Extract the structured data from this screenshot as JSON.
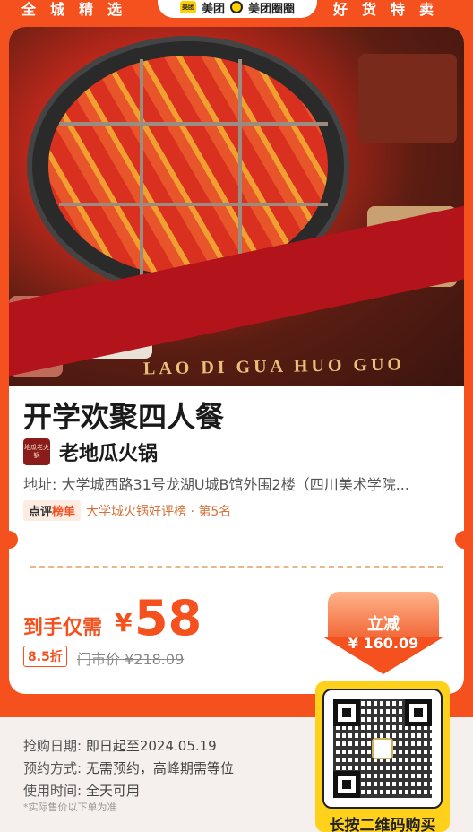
{
  "banner": {
    "left": "全城精选",
    "right": "好货特卖",
    "brand_logo": "美团",
    "brand_1": "美团",
    "brand_2": "美团圈圈"
  },
  "hero": {
    "ribbon_text": "LAO DI GUA HUO GUO"
  },
  "deal": {
    "title": "开学欢聚四人餐",
    "shop_name": "老地瓜火锅",
    "shop_logo_text": "地瓜老火锅",
    "address": "地址: 大学城西路31号龙湖U城B馆外围2楼（四川美术学院...",
    "rank_tag_a": "点评",
    "rank_tag_b": "榜单",
    "rank_text": "大学城火锅好评榜 · 第5名"
  },
  "price": {
    "label": "到手仅需",
    "currency": "¥",
    "value": "58",
    "discount": "8.5折",
    "market_price": "门市价 ¥218.09"
  },
  "reduce": {
    "label": "立减",
    "value": "¥ 160.09"
  },
  "info": {
    "rows": [
      {
        "key": "抢购日期:",
        "value": "即日起至2024.05.19"
      },
      {
        "key": "预约方式:",
        "value": "无需预约，高峰期需等位"
      },
      {
        "key": "使用时间:",
        "value": "全天可用"
      }
    ],
    "note": "*实际售价以下单为准"
  },
  "qr": {
    "label": "长按二维码购买",
    "icon": "qr-code-icon"
  },
  "colors": {
    "accent": "#f4511e",
    "qr_bg": "#ffd11a"
  }
}
